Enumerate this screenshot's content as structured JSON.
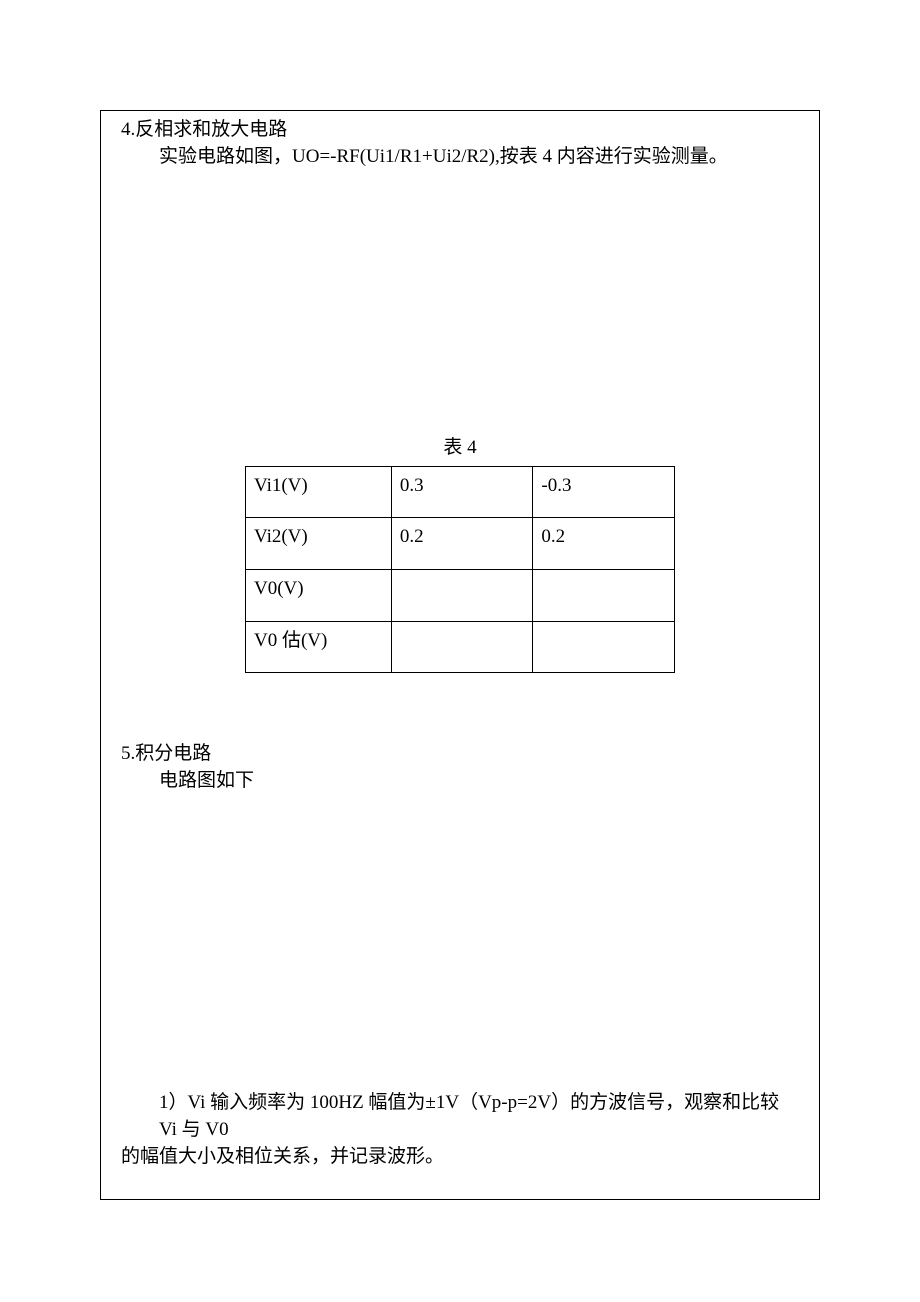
{
  "section4": {
    "title": "4.反相求和放大电路",
    "desc": "实验电路如图，UO=-RF(Ui1/R1+Ui2/R2),按表 4 内容进行实验测量。"
  },
  "table4": {
    "caption": "表 4",
    "rows": [
      {
        "label": "Vi1(V)",
        "c1": "0.3",
        "c2": "-0.3"
      },
      {
        "label": "Vi2(V)",
        "c1": "0.2",
        "c2": "0.2"
      },
      {
        "label": "V0(V)",
        "c1": "",
        "c2": ""
      },
      {
        "label": "V0 估(V)",
        "c1": "",
        "c2": ""
      }
    ]
  },
  "section5": {
    "title": "5.积分电路",
    "desc": "电路图如下",
    "body_line1": "1）Vi 输入频率为 100HZ 幅值为±1V（Vp-p=2V）的方波信号，观察和比较 Vi 与 V0",
    "body_line2": "的幅值大小及相位关系，并记录波形。"
  }
}
